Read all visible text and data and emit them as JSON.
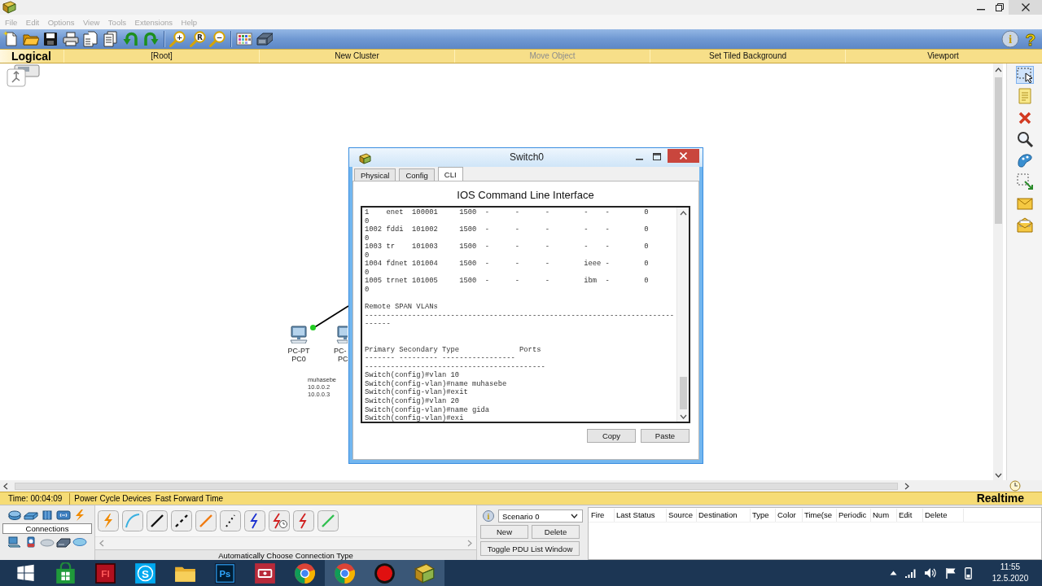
{
  "menu": [
    {
      "label": "File",
      "disabled": true
    },
    {
      "label": "Edit",
      "disabled": true
    },
    {
      "label": "Options",
      "disabled": true
    },
    {
      "label": "View",
      "disabled": true
    },
    {
      "label": "Tools",
      "disabled": true
    },
    {
      "label": "Extensions",
      "disabled": true
    },
    {
      "label": "Help",
      "disabled": true
    }
  ],
  "toolbar": {
    "groups": [
      [
        {
          "kind": "new"
        },
        {
          "kind": "open"
        },
        {
          "kind": "save"
        },
        {
          "kind": "print"
        },
        {
          "kind": "copy"
        },
        {
          "kind": "paste"
        },
        {
          "kind": "undo"
        },
        {
          "kind": "redo"
        }
      ],
      [
        {
          "kind": "zoom",
          "glyph": "+"
        },
        {
          "kind": "zoom",
          "glyph": "R"
        },
        {
          "kind": "zoom",
          "glyph": "−"
        }
      ],
      [
        {
          "kind": "palette"
        },
        {
          "kind": "device"
        }
      ]
    ],
    "help": [
      {
        "kind": "info",
        "glyph": "i"
      },
      {
        "kind": "help",
        "glyph": "?"
      }
    ]
  },
  "workspace_bar": {
    "mode": "Logical",
    "items": [
      {
        "label": "[Root]",
        "disabled": false
      },
      {
        "label": "New Cluster",
        "disabled": false
      },
      {
        "label": "Move Object",
        "disabled": true
      },
      {
        "label": "Set Tiled Background",
        "disabled": false
      },
      {
        "label": "Viewport",
        "disabled": false
      }
    ]
  },
  "canvas": {
    "devices": [
      {
        "model": "PC-PT",
        "name": "PC0"
      },
      {
        "model": "PC-",
        "name": "PC"
      }
    ],
    "note": [
      "muhasebe",
      "10.0.0.2",
      "10.0.0.3"
    ]
  },
  "tools": [
    {
      "kind": "select",
      "selected": true
    },
    {
      "kind": "note",
      "selected": false
    },
    {
      "kind": "delete",
      "selected": false
    },
    {
      "kind": "inspect",
      "selected": false
    },
    {
      "kind": "shape",
      "selected": false
    },
    {
      "kind": "resize",
      "selected": false
    },
    {
      "kind": "simple_pdu",
      "selected": false
    },
    {
      "kind": "complex_pdu",
      "selected": false
    }
  ],
  "device_window": {
    "title": "Switch0",
    "tabs": [
      {
        "label": "Physical",
        "selected": false
      },
      {
        "label": "Config",
        "selected": false
      },
      {
        "label": "CLI",
        "selected": true
      }
    ],
    "heading": "IOS Command Line Interface",
    "terminal": "1    enet  100001     1500  -      -      -        -    -        0\n0\n1002 fddi  101002     1500  -      -      -        -    -        0\n0\n1003 tr    101003     1500  -      -      -        -    -        0\n0\n1004 fdnet 101004     1500  -      -      -        ieee -        0\n0\n1005 trnet 101005     1500  -      -      -        ibm  -        0\n0\n\nRemote SPAN VLANs\n------------------------------------------------------------------------\n------\n\n\nPrimary Secondary Type              Ports\n------- --------- -----------------\n------------------------------------------\nSwitch(config)#vlan 10\nSwitch(config-vlan)#name muhasebe\nSwitch(config-vlan)#exit\nSwitch(config)#vlan 20\nSwitch(config-vlan)#name gida\nSwitch(config-vlan)#exi",
    "buttons": [
      "Copy",
      "Paste"
    ]
  },
  "time_bar": {
    "time": "Time: 00:04:09",
    "actions": [
      "Power Cycle Devices",
      "Fast Forward Time"
    ],
    "mode": "Realtime"
  },
  "device_panel": {
    "category": "Connections",
    "connection_hint": "Automatically Choose Connection Type"
  },
  "scenario": {
    "info_glyph": "i",
    "value": "Scenario 0",
    "buttons": [
      "New",
      "Delete"
    ],
    "toggle": "Toggle PDU List Window"
  },
  "pdu_table": {
    "columns": [
      "Fire",
      "Last Status",
      "Source",
      "Destination",
      "Type",
      "Color",
      "Time(se",
      "Periodic",
      "Num",
      "Edit",
      "Delete"
    ]
  },
  "taskbar": {
    "apps": [
      {
        "kind": "start",
        "selected": false
      },
      {
        "kind": "store",
        "selected": false
      },
      {
        "kind": "flash",
        "glyph": "Fl",
        "selected": false
      },
      {
        "kind": "skype",
        "glyph": "S",
        "selected": false
      },
      {
        "kind": "explorer",
        "selected": false
      },
      {
        "kind": "photoshop",
        "glyph": "Ps",
        "selected": false
      },
      {
        "kind": "capture",
        "selected": false
      },
      {
        "kind": "chrome",
        "selected": false
      },
      {
        "kind": "chrome",
        "selected": true
      },
      {
        "kind": "record",
        "selected": true
      },
      {
        "kind": "tracer",
        "selected": true
      }
    ],
    "time": "11:55",
    "date": "12.5.2020"
  }
}
